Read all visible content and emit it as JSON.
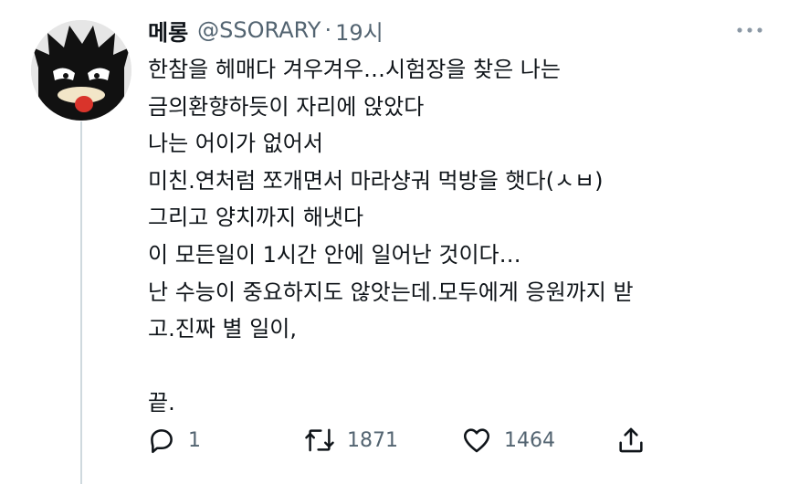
{
  "tweet": {
    "display_name": "메롱",
    "handle": "@SSORARY",
    "separator": "·",
    "time": "19시",
    "more_icon": "more-horizontal-icon",
    "avatar_icon": "badtz-maru-avatar",
    "lines": [
      "한참을 헤매다 겨우겨우…시험장을 찾은 나는",
      "금의환향하듯이 자리에 앉았다",
      "나는 어이가 없어서",
      "미친.연처럼 쪼개면서 마라샹궈 먹방을 햇다(ㅅㅂ)",
      "그리고 양치까지 해냇다",
      "이 모든일이 1시간 안에 일어난 것이다…",
      "난 수능이 중요하지도 않앗는데.모두에게 응원까지 받",
      "고.진짜 별 일이,",
      "",
      "끝."
    ]
  },
  "actions": {
    "reply": {
      "icon": "reply-icon",
      "count": "1"
    },
    "retweet": {
      "icon": "retweet-icon",
      "count": "1871"
    },
    "like": {
      "icon": "heart-icon",
      "count": "1464"
    },
    "share": {
      "icon": "share-icon"
    }
  },
  "colors": {
    "text": "#0f1419",
    "secondary": "#536471",
    "thread_line": "#cfd9de"
  }
}
